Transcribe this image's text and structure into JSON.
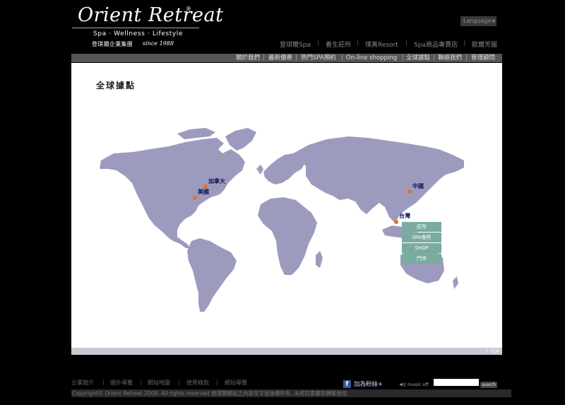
{
  "logo": {
    "title": "Orient Retreat",
    "registered": "®",
    "tagline": "Spa · Wellness · Lifestyle",
    "group": "登琪爾企業集團",
    "since": "since 1988"
  },
  "language": {
    "label": "Language",
    "arrow": "▼"
  },
  "top_nav": [
    "登琪爾Spa",
    "養生莊所",
    "璞真Resort",
    "Spa商品專賣店",
    "歐爾芳園"
  ],
  "top_nav_sep": "|",
  "sub_nav": [
    "關於我們",
    "最新優惠",
    "熱門SPA預約",
    "On-line shopping",
    "全球據點",
    "聯絡我們",
    "管理顧問"
  ],
  "sub_nav_sep": "|",
  "page": {
    "title": "全球據點",
    "top_link": "↑ TOP"
  },
  "map": {
    "locations": [
      {
        "label": "加拿大"
      },
      {
        "label": "美國"
      },
      {
        "label": "中國"
      },
      {
        "label": "台灣"
      }
    ],
    "menu": [
      "莊所",
      "SPA會所",
      "SHOP",
      "門市"
    ],
    "colors": {
      "land": "#9d9bbd",
      "pin": "#e0731c",
      "menu": "#7aaba0",
      "label": "#12185a"
    }
  },
  "footer": {
    "links": [
      "企業簡介",
      "國外導覽",
      "網站地圖",
      "使用條款",
      "網站導覽"
    ],
    "sep": "|",
    "facebook_icon": "f",
    "facebook_label": "加為粉絲+",
    "music_label": "music off",
    "search_value": "",
    "search_button": "search",
    "copyright": "Copyright© Orient Retreat 2009. All rights reserved 登琪爾網站之內容文字皆版權所有, 未經同意嚴禁轉載使用"
  }
}
